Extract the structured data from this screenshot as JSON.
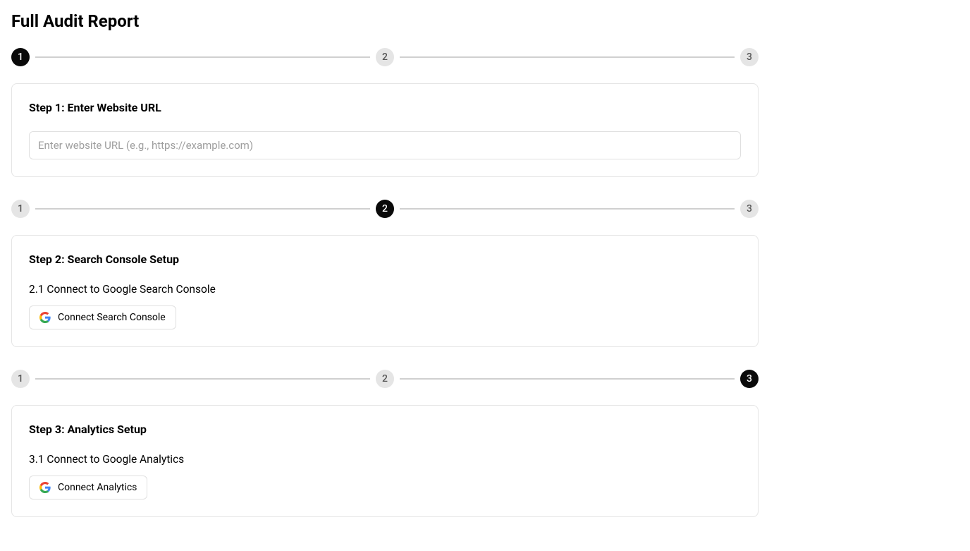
{
  "page": {
    "title": "Full Audit Report"
  },
  "stepper": {
    "step1": "1",
    "step2": "2",
    "step3": "3"
  },
  "step1": {
    "title": "Step 1: Enter Website URL",
    "placeholder": "Enter website URL (e.g., https://example.com)"
  },
  "step2": {
    "title": "Step 2: Search Console Setup",
    "sub": "2.1 Connect to Google Search Console",
    "button": "Connect Search Console"
  },
  "step3": {
    "title": "Step 3: Analytics Setup",
    "sub": "3.1 Connect to Google Analytics",
    "button": "Connect Analytics"
  }
}
